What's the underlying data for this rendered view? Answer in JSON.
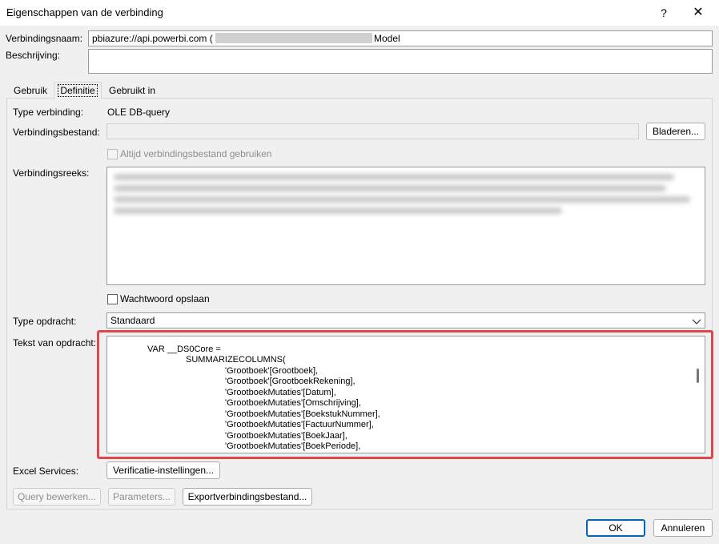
{
  "window": {
    "title": "Eigenschappen van de verbinding",
    "help": "?",
    "close": "✕"
  },
  "header": {
    "name_label": "Verbindingsnaam:",
    "name_value_prefix": "pbiazure://api.powerbi.com (",
    "name_value_suffix": "Model",
    "description_label": "Beschrijving:",
    "description_value": ""
  },
  "tabs": [
    {
      "label": "Gebruik",
      "active": false
    },
    {
      "label": "Definitie",
      "active": true
    },
    {
      "label": "Gebruikt in",
      "active": false
    }
  ],
  "definition": {
    "type_label": "Type verbinding:",
    "type_value": "OLE DB-query",
    "file_label": "Verbindingsbestand:",
    "file_value": "",
    "browse_button": "Bladeren...",
    "always_use_file_label": "Altijd verbindingsbestand gebruiken",
    "connstring_label": "Verbindingsreeks:",
    "save_password_label": "Wachtwoord opslaan",
    "command_type_label": "Type opdracht:",
    "command_type_value": "Standaard",
    "command_text_label": "Tekst van opdracht:",
    "command_text_lines": [
      "VAR __DS0Core =",
      "SUMMARIZECOLUMNS(",
      "'Grootboek'[Grootboek],",
      "'Grootboek'[GrootboekRekening],",
      "'GrootboekMutaties'[Datum],",
      "'GrootboekMutaties'[Omschrijving],",
      "'GrootboekMutaties'[BoekstukNummer],",
      "'GrootboekMutaties'[FactuurNummer],",
      "'GrootboekMutaties'[BoekJaar],",
      "'GrootboekMutaties'[BoekPeriode],"
    ],
    "excel_services_label": "Excel Services:",
    "auth_settings_button": "Verificatie-instellingen..."
  },
  "actions": {
    "edit_query": "Query bewerken...",
    "parameters": "Parameters...",
    "export": "Exportverbindingsbestand..."
  },
  "footer": {
    "ok": "OK",
    "cancel": "Annuleren"
  },
  "colors": {
    "highlight_border": "#e0474c",
    "ok_border": "#0067c0"
  }
}
